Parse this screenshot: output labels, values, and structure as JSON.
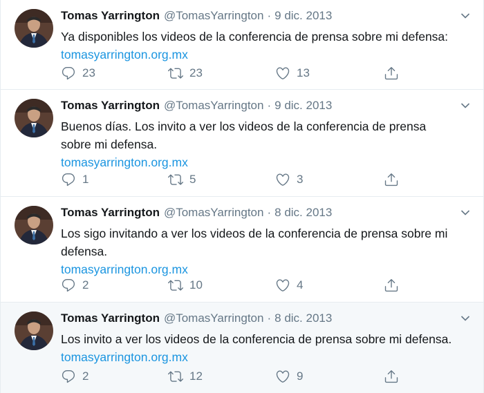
{
  "tweets": [
    {
      "name": "Tomas Yarrington",
      "handle": "@TomasYarrington",
      "separator": "·",
      "date": "9 dic. 2013",
      "text": "Ya disponibles los videos de la conferencia de prensa sobre mi defensa:",
      "link": "tomasyarrington.org.mx",
      "replies": "23",
      "retweets": "23",
      "likes": "13"
    },
    {
      "name": "Tomas Yarrington",
      "handle": "@TomasYarrington",
      "separator": "·",
      "date": "9 dic. 2013",
      "text": "Buenos días. Los invito a ver los videos de la conferencia de prensa sobre mi defensa.",
      "link": "tomasyarrington.org.mx",
      "replies": "1",
      "retweets": "5",
      "likes": "3"
    },
    {
      "name": "Tomas Yarrington",
      "handle": "@TomasYarrington",
      "separator": "·",
      "date": "8 dic. 2013",
      "text": "Los sigo invitando a ver los videos de la conferencia de prensa sobre mi defensa.",
      "link": "tomasyarrington.org.mx",
      "replies": "2",
      "retweets": "10",
      "likes": "4"
    },
    {
      "name": "Tomas Yarrington",
      "handle": "@TomasYarrington",
      "separator": "·",
      "date": "8 dic. 2013",
      "text": "Los invito a ver los videos de la conferencia de prensa sobre mi defensa.",
      "link": "tomasyarrington.org.mx",
      "replies": "2",
      "retweets": "12",
      "likes": "9"
    }
  ],
  "icons": {
    "avatar": "profile-photo",
    "caret": "chevron-down-icon",
    "reply": "reply-icon",
    "retweet": "retweet-icon",
    "like": "heart-icon",
    "share": "share-icon"
  },
  "colors": {
    "text": "#14171a",
    "secondary": "#657786",
    "link": "#1b95e0",
    "highlight_bg": "#f5f8fa",
    "divider": "#e6ecf0"
  }
}
